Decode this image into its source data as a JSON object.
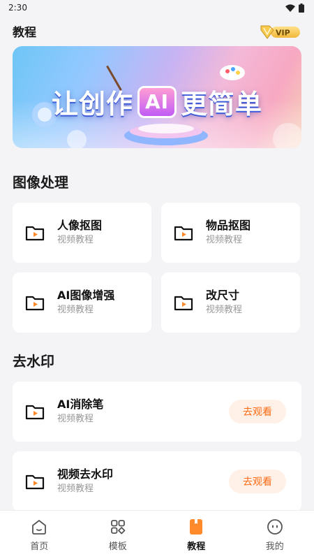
{
  "status": {
    "time": "2:30"
  },
  "header": {
    "title": "教程",
    "vip_label": "VIP"
  },
  "banner": {
    "text_left": "让创作",
    "text_ai": "AI",
    "text_right": "更简单"
  },
  "sections": {
    "image": {
      "title": "图像处理",
      "items": [
        {
          "title": "人像抠图",
          "subtitle": "视频教程"
        },
        {
          "title": "物品抠图",
          "subtitle": "视频教程"
        },
        {
          "title": "AI图像增强",
          "subtitle": "视频教程"
        },
        {
          "title": "改尺寸",
          "subtitle": "视频教程"
        }
      ]
    },
    "watermark": {
      "title": "去水印",
      "items": [
        {
          "title": "AI消除笔",
          "subtitle": "视频教程",
          "button": "去观看"
        },
        {
          "title": "视频去水印",
          "subtitle": "视频教程",
          "button": "去观看"
        }
      ]
    }
  },
  "tabbar": {
    "items": [
      {
        "label": "首页"
      },
      {
        "label": "模板"
      },
      {
        "label": "教程"
      },
      {
        "label": "我的"
      }
    ],
    "active": "教程",
    "accent": "#ff8a2b"
  }
}
